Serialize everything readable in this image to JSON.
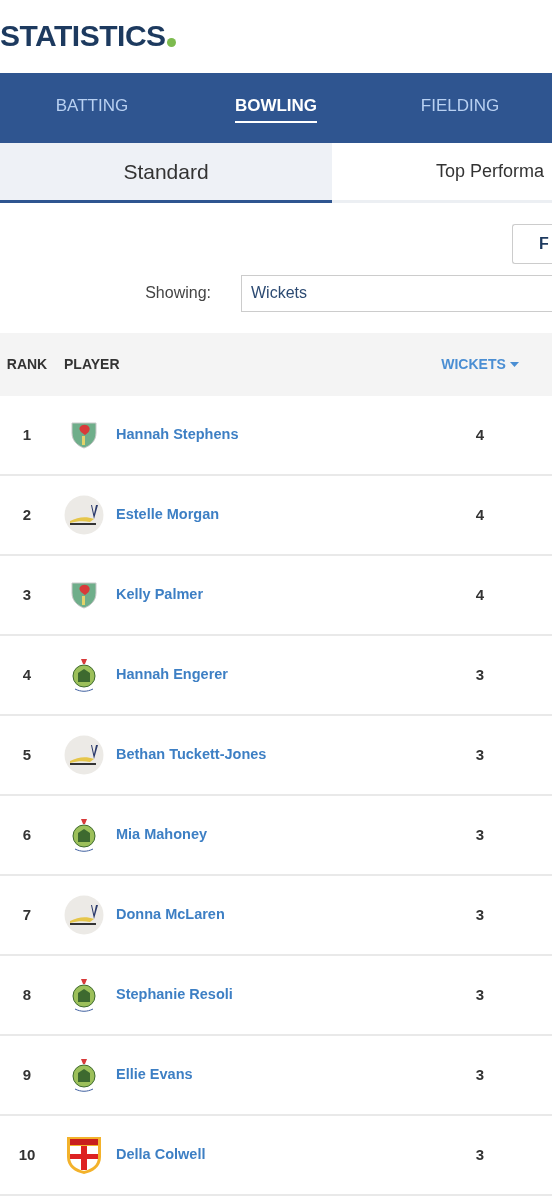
{
  "title": "STATISTICS",
  "nav_tabs": [
    {
      "label": "BATTING",
      "selected": false
    },
    {
      "label": "BOWLING",
      "selected": true
    },
    {
      "label": "FIELDING",
      "selected": false
    }
  ],
  "sub_tabs": [
    {
      "label": "Standard",
      "selected": true
    },
    {
      "label": "Top Performa",
      "selected": false
    }
  ],
  "filter_button": "F",
  "showing": {
    "label": "Showing:",
    "value": "Wickets"
  },
  "table": {
    "columns": [
      {
        "label": "RANK",
        "sorted": false
      },
      {
        "label": "PLAYER",
        "sorted": false
      },
      {
        "label": "WICKETS",
        "sorted": true
      }
    ],
    "rows": [
      {
        "rank": "1",
        "kind": "shield",
        "player": "Hannah Stephens",
        "wickets": "4"
      },
      {
        "rank": "2",
        "kind": "disc",
        "player": "Estelle Morgan",
        "wickets": "4"
      },
      {
        "rank": "3",
        "kind": "shield",
        "player": "Kelly Palmer",
        "wickets": "4"
      },
      {
        "rank": "4",
        "kind": "crest",
        "player": "Hannah Engerer",
        "wickets": "3"
      },
      {
        "rank": "5",
        "kind": "disc",
        "player": "Bethan Tuckett-Jones",
        "wickets": "3"
      },
      {
        "rank": "6",
        "kind": "crest",
        "player": "Mia Mahoney",
        "wickets": "3"
      },
      {
        "rank": "7",
        "kind": "disc",
        "player": "Donna McLaren",
        "wickets": "3"
      },
      {
        "rank": "8",
        "kind": "crest",
        "player": "Stephanie Resoli",
        "wickets": "3"
      },
      {
        "rank": "9",
        "kind": "crest",
        "player": "Ellie Evans",
        "wickets": "3"
      },
      {
        "rank": "10",
        "kind": "cross",
        "player": "Della Colwell",
        "wickets": "3"
      }
    ]
  }
}
